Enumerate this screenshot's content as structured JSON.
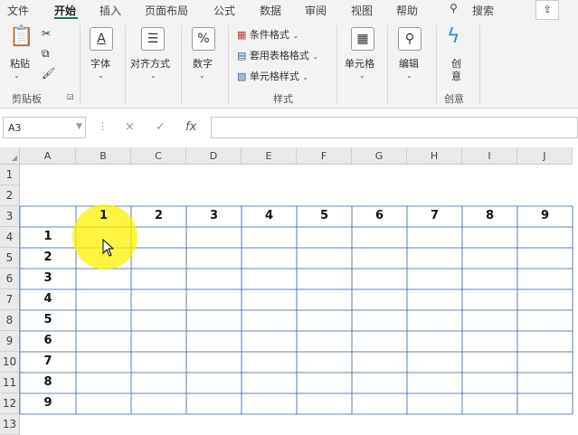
{
  "tabs": [
    "文件",
    "开始",
    "插入",
    "页面布局",
    "公式",
    "数据",
    "审阅",
    "视图",
    "帮助",
    "搜索"
  ],
  "ribbon": {
    "clipboard": {
      "paste": "粘贴",
      "group": "剪贴板"
    },
    "font": "字体",
    "alignment": "对齐方式",
    "number": "数字",
    "styles": {
      "conditional": "条件格式",
      "table": "套用表格格式",
      "cell_styles": "单元格样式",
      "group": "样式"
    },
    "cells": "单元格",
    "editing": "编辑",
    "create": [
      "创",
      "意"
    ],
    "create_group": "创意"
  },
  "formula_bar": {
    "name_box": "A3",
    "cancel": "×",
    "enter": "✓",
    "fx": "fx",
    "formula": ""
  },
  "columns": [
    "A",
    "B",
    "C",
    "D",
    "E",
    "F",
    "G",
    "H",
    "I",
    "J"
  ],
  "rows": [
    "1",
    "2",
    "3",
    "4",
    "5",
    "6",
    "7",
    "8",
    "9",
    "10",
    "11",
    "12",
    "13"
  ],
  "header_row": [
    "1",
    "2",
    "3",
    "4",
    "5",
    "6",
    "7",
    "8",
    "9"
  ],
  "header_col": [
    "1",
    "2",
    "3",
    "4",
    "5",
    "6",
    "7",
    "8",
    "9"
  ],
  "colors": {
    "accent": "#217346",
    "table_border": "#2e5f9e",
    "highlight": "#fff000"
  }
}
